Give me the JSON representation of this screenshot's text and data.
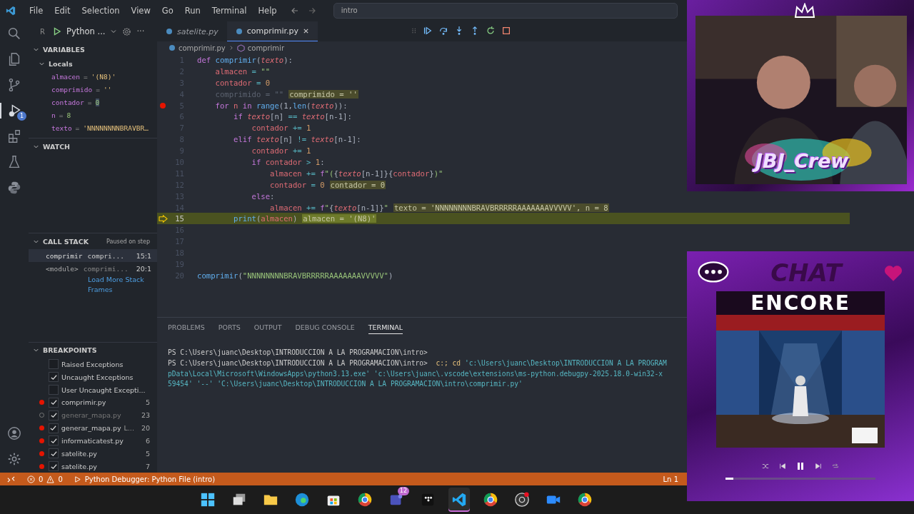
{
  "menu": [
    "File",
    "Edit",
    "Selection",
    "View",
    "Go",
    "Run",
    "Terminal",
    "Help"
  ],
  "command_center": "intro",
  "activity_badge": "1",
  "run_panel": {
    "prefix": "R",
    "config": "Python ...",
    "more": "···"
  },
  "variables": {
    "title": "VARIABLES",
    "scope": "Locals",
    "expanded": true,
    "items": [
      {
        "name": "almacen",
        "sep": "=",
        "value": "'(N8)'",
        "kind": "string"
      },
      {
        "name": "comprimido",
        "sep": "=",
        "value": "''",
        "kind": "string"
      },
      {
        "name": "contador",
        "sep": "=",
        "value": "0",
        "kind": "number",
        "changed": true
      },
      {
        "name": "n",
        "sep": "=",
        "value": "8",
        "kind": "number",
        "changed": false
      },
      {
        "name": "texto",
        "sep": "=",
        "value": "'NNNNNNNNBRAVBR…",
        "kind": "string"
      }
    ]
  },
  "watch": {
    "title": "WATCH"
  },
  "call_stack": {
    "title": "CALL STACK",
    "status": "Paused on step",
    "more": "Load More Stack Frames",
    "frames": [
      {
        "name": "comprimir",
        "file": "compri...",
        "pos": "15:1",
        "selected": true
      },
      {
        "name": "<module>",
        "file": "comprimi...",
        "pos": "20:1",
        "selected": false
      }
    ]
  },
  "breakpoints": {
    "title": "BREAKPOINTS",
    "items": [
      {
        "kind": "exception",
        "label": "Raised Exceptions",
        "checked": false
      },
      {
        "kind": "exception",
        "label": "Uncaught Exceptions",
        "checked": true
      },
      {
        "kind": "exception",
        "label": "User Uncaught Excepti...",
        "checked": false
      },
      {
        "kind": "file",
        "label": "comprimir.py",
        "line": "5",
        "checked": true,
        "verified": true
      },
      {
        "kind": "file",
        "label": "generar_mapa.py",
        "line": "23",
        "checked": true,
        "verified": false
      },
      {
        "kind": "file",
        "label": "generar_mapa.py",
        "extra": "L...",
        "line": "20",
        "checked": true,
        "verified": true
      },
      {
        "kind": "file",
        "label": "informaticatest.py",
        "line": "6",
        "checked": true,
        "verified": true
      },
      {
        "kind": "file",
        "label": "satelite.py",
        "line": "5",
        "checked": true,
        "verified": true
      },
      {
        "kind": "file",
        "label": "satelite.py",
        "line": "7",
        "checked": true,
        "verified": true
      }
    ]
  },
  "tabs": [
    {
      "label": "satelite.py",
      "selected": false,
      "preview": true
    },
    {
      "label": "comprimir.py",
      "selected": true,
      "preview": false
    }
  ],
  "breadcrumb": [
    "comprimir.py",
    "comprimir"
  ],
  "lines": [
    {
      "n": "1",
      "tokens": [
        {
          "kind": "kw",
          "text": "def "
        },
        {
          "kind": "fn",
          "text": "comprimir"
        },
        {
          "kind": "punc",
          "text": "("
        },
        {
          "kind": "param",
          "text": "texto"
        },
        {
          "kind": "punc",
          "text": "):"
        }
      ]
    },
    {
      "n": "2",
      "tokens": [
        {
          "kind": "var",
          "text": "    almacen"
        },
        {
          "kind": "op",
          "text": " = "
        },
        {
          "kind": "str",
          "text": "\"\""
        }
      ]
    },
    {
      "n": "3",
      "tokens": [
        {
          "kind": "var",
          "text": "    contador"
        },
        {
          "kind": "op",
          "text": " = "
        },
        {
          "kind": "num",
          "text": "0"
        }
      ]
    },
    {
      "n": "4",
      "tokens": [
        {
          "kind": "dim",
          "text": "    comprimido = \"\""
        }
      ],
      "hint": "comprimido = ''"
    },
    {
      "n": "5",
      "tokens": [
        {
          "kind": "kw",
          "text": "    for "
        },
        {
          "kind": "var",
          "text": "n"
        },
        {
          "kind": "kw",
          "text": " in "
        },
        {
          "kind": "fn",
          "text": "range"
        },
        {
          "kind": "punc",
          "text": "(1,"
        },
        {
          "kind": "fn",
          "text": "len"
        },
        {
          "kind": "punc",
          "text": "("
        },
        {
          "kind": "param",
          "text": "texto"
        },
        {
          "kind": "punc",
          "text": ")):"
        }
      ],
      "breakpoint": true
    },
    {
      "n": "6",
      "tokens": [
        {
          "kind": "kw",
          "text": "        if "
        },
        {
          "kind": "param",
          "text": "texto"
        },
        {
          "kind": "punc",
          "text": "[n] "
        },
        {
          "kind": "op",
          "text": "== "
        },
        {
          "kind": "param",
          "text": "texto"
        },
        {
          "kind": "punc",
          "text": "[n-1]:"
        }
      ]
    },
    {
      "n": "7",
      "tokens": [
        {
          "kind": "var",
          "text": "            contador"
        },
        {
          "kind": "op",
          "text": " += "
        },
        {
          "kind": "num",
          "text": "1"
        }
      ]
    },
    {
      "n": "8",
      "tokens": [
        {
          "kind": "kw",
          "text": "        elif "
        },
        {
          "kind": "param",
          "text": "texto"
        },
        {
          "kind": "punc",
          "text": "[n] "
        },
        {
          "kind": "op",
          "text": "!= "
        },
        {
          "kind": "param",
          "text": "texto"
        },
        {
          "kind": "punc",
          "text": "[n-1]:"
        }
      ]
    },
    {
      "n": "9",
      "tokens": [
        {
          "kind": "var",
          "text": "            contador"
        },
        {
          "kind": "op",
          "text": " += "
        },
        {
          "kind": "num",
          "text": "1"
        }
      ]
    },
    {
      "n": "10",
      "tokens": [
        {
          "kind": "kw",
          "text": "            if "
        },
        {
          "kind": "var",
          "text": "contador"
        },
        {
          "kind": "op",
          "text": " > "
        },
        {
          "kind": "num",
          "text": "1"
        },
        {
          "kind": "punc",
          "text": ":"
        }
      ]
    },
    {
      "n": "11",
      "tokens": [
        {
          "kind": "var",
          "text": "                almacen"
        },
        {
          "kind": "op",
          "text": " += "
        },
        {
          "kind": "kw",
          "text": "f"
        },
        {
          "kind": "str",
          "text": "\"("
        },
        {
          "kind": "punc",
          "text": "{"
        },
        {
          "kind": "param",
          "text": "texto"
        },
        {
          "kind": "punc",
          "text": "[n-1]}{"
        },
        {
          "kind": "var",
          "text": "contador"
        },
        {
          "kind": "punc",
          "text": "}"
        },
        {
          "kind": "str",
          "text": ")\""
        }
      ]
    },
    {
      "n": "12",
      "tokens": [
        {
          "kind": "var",
          "text": "                contador"
        },
        {
          "kind": "op",
          "text": " = "
        },
        {
          "kind": "num",
          "text": "0"
        }
      ],
      "hint": "contador = 0"
    },
    {
      "n": "13",
      "tokens": [
        {
          "kind": "kw",
          "text": "            else"
        },
        {
          "kind": "punc",
          "text": ":"
        }
      ]
    },
    {
      "n": "14",
      "tokens": [
        {
          "kind": "var",
          "text": "                almacen"
        },
        {
          "kind": "op",
          "text": " += "
        },
        {
          "kind": "kw",
          "text": "f"
        },
        {
          "kind": "str",
          "text": "\""
        },
        {
          "kind": "punc",
          "text": "{"
        },
        {
          "kind": "param",
          "text": "texto"
        },
        {
          "kind": "punc",
          "text": "[n-1]}"
        },
        {
          "kind": "str",
          "text": "\""
        }
      ],
      "hint": "texto = 'NNNNNNNNBRAVBRRRRRAAAAAAAVVVVV', n = 8"
    },
    {
      "n": "15",
      "tokens": [
        {
          "kind": "fn",
          "text": "        print"
        },
        {
          "kind": "punc",
          "text": "("
        },
        {
          "kind": "var",
          "text": "almacen"
        },
        {
          "kind": "punc",
          "text": ")"
        }
      ],
      "hint": "almacen = '(N8)'",
      "current": true
    },
    {
      "n": "16"
    },
    {
      "n": "17"
    },
    {
      "n": "18"
    },
    {
      "n": "19"
    },
    {
      "n": "20",
      "tokens": [
        {
          "kind": "fn",
          "text": "comprimir"
        },
        {
          "kind": "punc",
          "text": "("
        },
        {
          "kind": "str",
          "text": "\"NNNNNNNNBRAVBRRRRRAAAAAAAVVVVV\""
        },
        {
          "kind": "punc",
          "text": ")"
        }
      ]
    }
  ],
  "panel_tabs": [
    {
      "label": "PROBLEMS",
      "selected": false
    },
    {
      "label": "PORTS",
      "selected": false
    },
    {
      "label": "OUTPUT",
      "selected": false
    },
    {
      "label": "DEBUG CONSOLE",
      "selected": false
    },
    {
      "label": "TERMINAL",
      "selected": true
    }
  ],
  "terminal": [
    [
      {
        "kind": "plain",
        "text": "PS C:\\Users\\juanc\\Desktop\\INTRODUCCION A LA PROGRAMACION\\intro>"
      }
    ],
    [
      {
        "kind": "plain",
        "text": "PS C:\\Users\\juanc\\Desktop\\INTRODUCCION A LA PROGRAMACION\\intro>  "
      },
      {
        "kind": "cmd",
        "text": "c:; cd "
      },
      {
        "kind": "arg",
        "text": "'c:\\Users\\juanc\\Desktop\\INTRODUCCION A LA PROGRAM"
      }
    ],
    [
      {
        "kind": "arg",
        "text": "pData\\Local\\Microsoft\\WindowsApps\\python3.13.exe' 'c:\\Users\\juanc\\.vscode\\extensions\\ms-python.debugpy-2025.18.0-win32-x"
      }
    ],
    [
      {
        "kind": "arg",
        "text": "59454' '--' 'C:\\Users\\juanc\\Desktop\\INTRODUCCION A LA PROGRAMACION\\intro\\comprimir.py'"
      }
    ]
  ],
  "status_bar": {
    "errors": "0",
    "warnings": "0",
    "debug": "Python Debugger: Python File (intro)",
    "position": "Ln 1"
  },
  "taskbar": [
    {
      "kind": "start",
      "selected": false
    },
    {
      "kind": "stack",
      "selected": false
    },
    {
      "kind": "folder",
      "selected": false
    },
    {
      "kind": "wave",
      "selected": false
    },
    {
      "kind": "bag",
      "selected": false
    },
    {
      "kind": "ring",
      "selected": false
    },
    {
      "kind": "people",
      "selected": false,
      "badge": "12"
    },
    {
      "kind": "diamonds",
      "selected": false
    },
    {
      "kind": "code",
      "selected": true
    },
    {
      "kind": "ring",
      "selected": false
    },
    {
      "kind": "aperture",
      "selected": false
    },
    {
      "kind": "camera",
      "selected": false
    },
    {
      "kind": "ring",
      "selected": false
    }
  ],
  "webcam": {
    "logo": "JBJ_Crew"
  },
  "music": {
    "heading": "CHAT",
    "album": "ENCORE",
    "playing": true,
    "level": 0.05
  }
}
